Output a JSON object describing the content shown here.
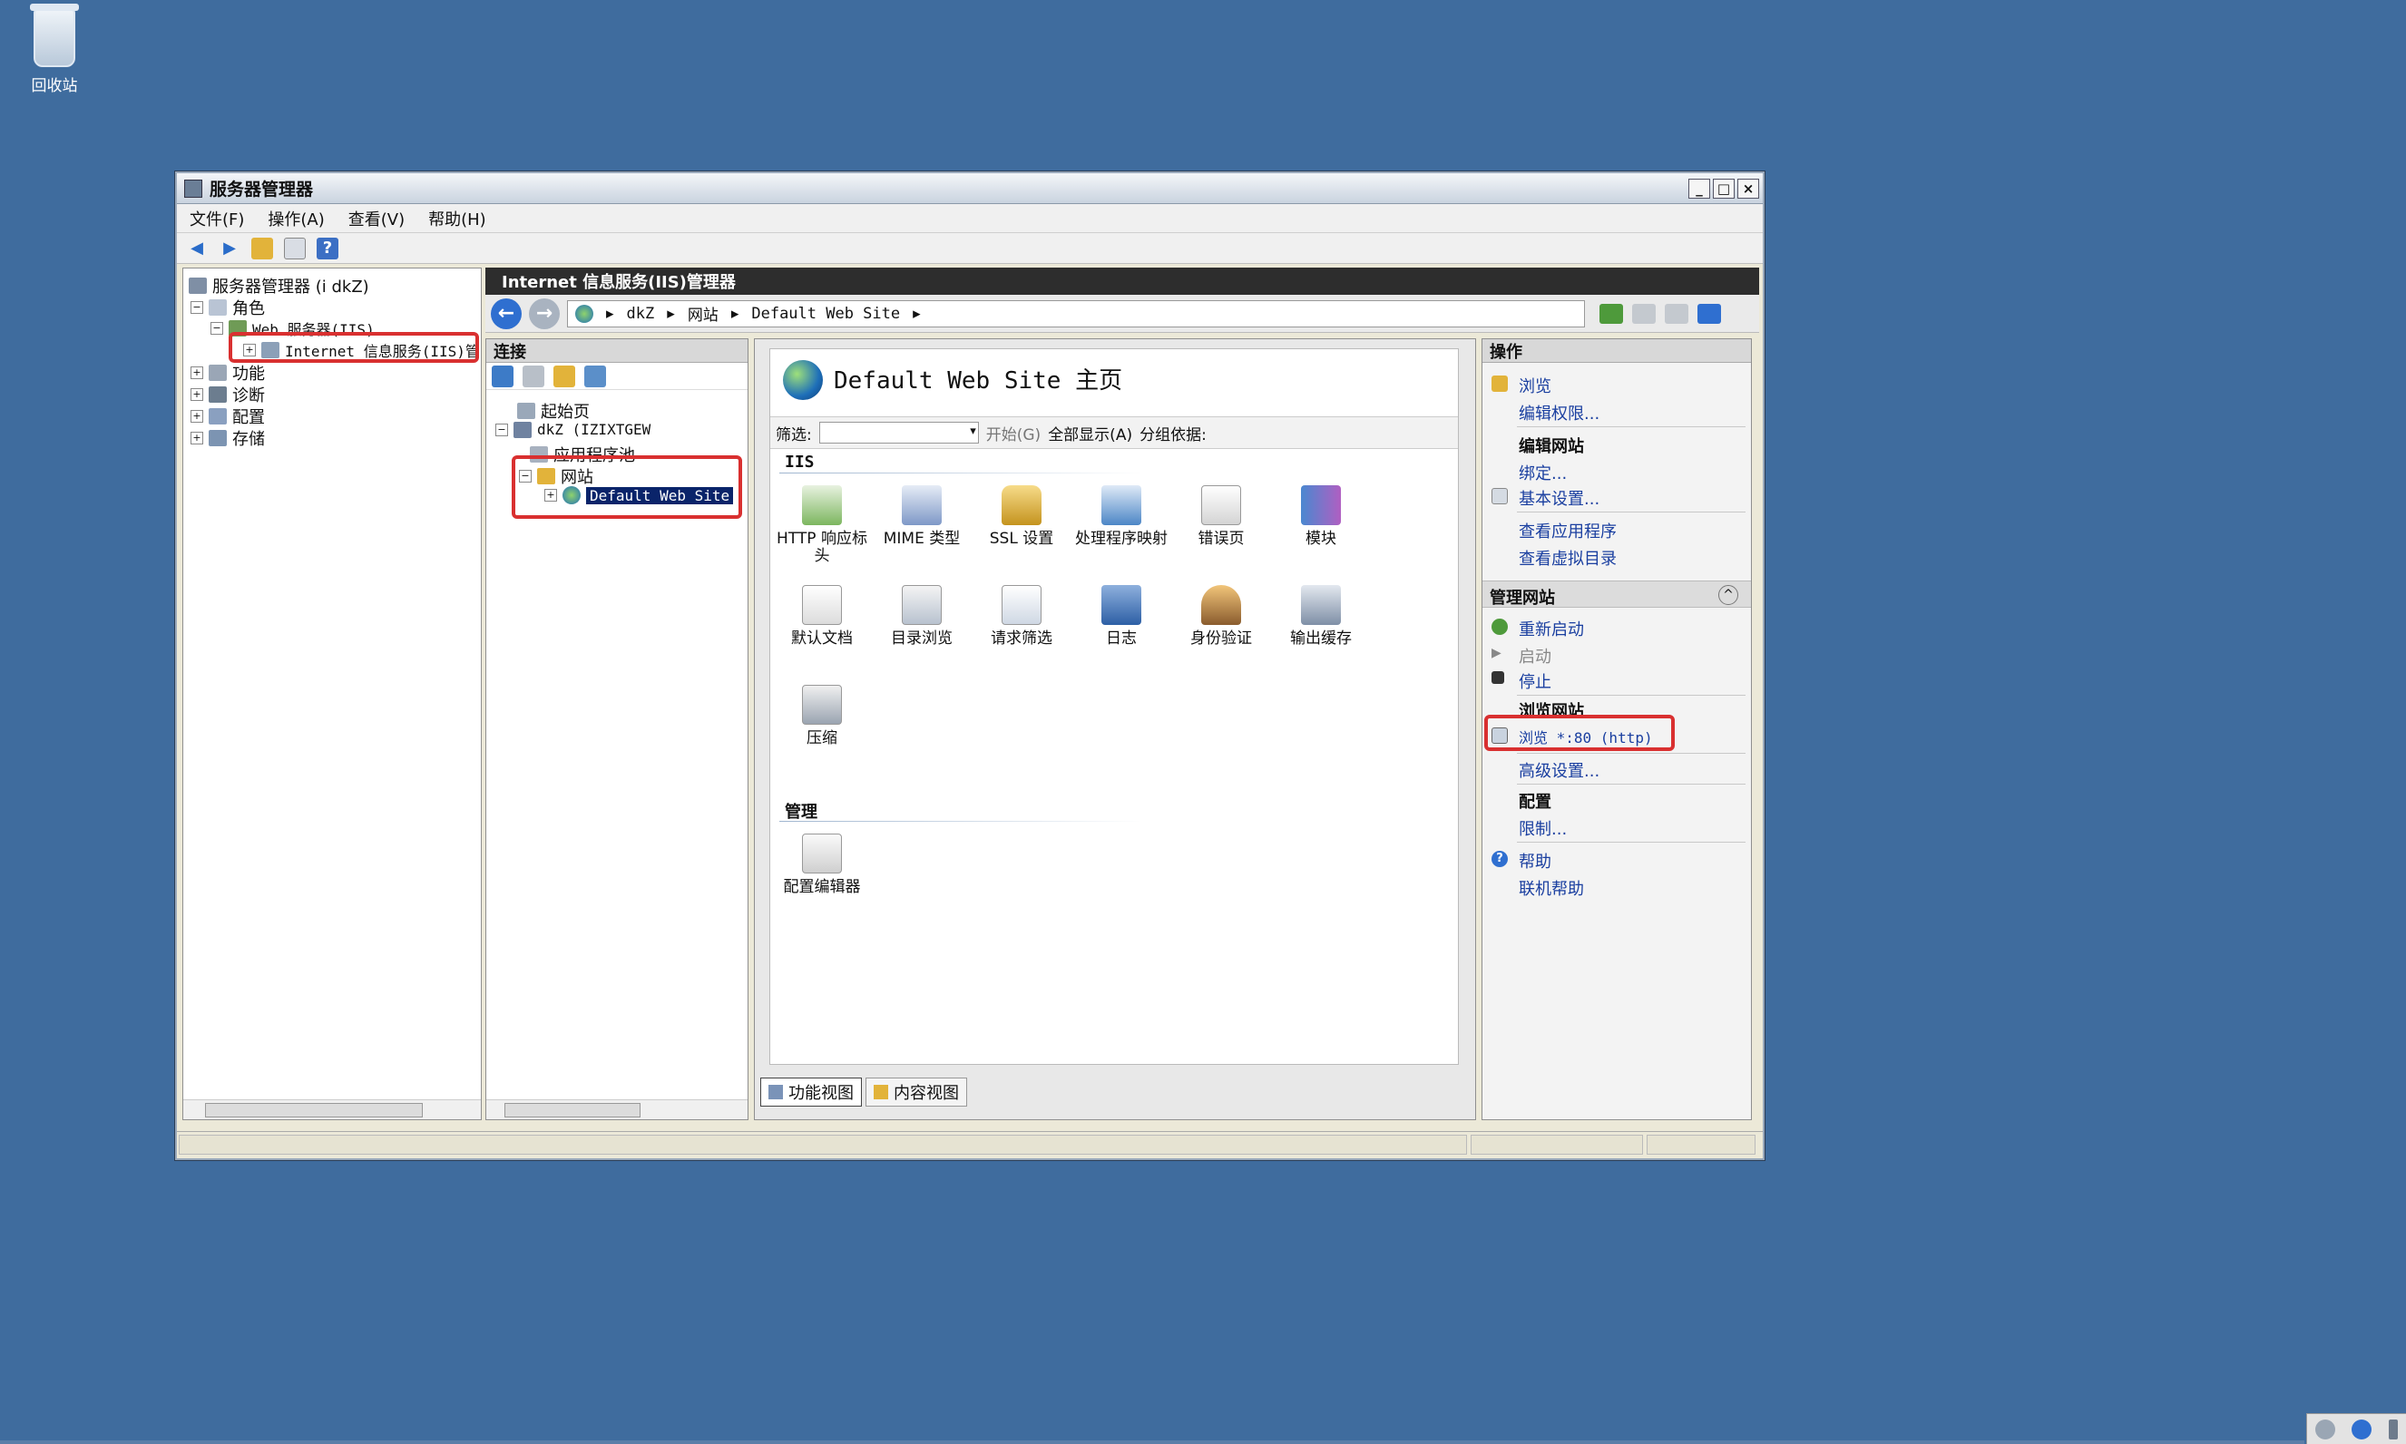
{
  "desktop": {
    "recycle_bin_label": "回收站"
  },
  "window": {
    "title": "服务器管理器",
    "menu": [
      "文件(F)",
      "操作(A)",
      "查看(V)",
      "帮助(H)"
    ]
  },
  "left_tree": {
    "root": "服务器管理器 (i          dkZ)",
    "roles": "角色",
    "web_server": "Web 服务器(IIS)",
    "iis_manager": "Internet 信息服务(IIS)管",
    "features": "功能",
    "diagnostics": "诊断",
    "configuration": "配置",
    "storage": "存储"
  },
  "iis": {
    "header": "Internet 信息服务(IIS)管理器",
    "address": [
      "               dkZ",
      "网站",
      "Default Web Site"
    ],
    "connections": {
      "title": "连接",
      "start_page": "起始页",
      "server": "          dkZ (IZIXTGEW",
      "app_pools": "应用程序池",
      "sites": "网站",
      "default_site": "Default Web Site"
    },
    "center": {
      "page_title": "Default Web Site 主页",
      "filter_label": "筛选:",
      "start_label": "开始(G)",
      "show_all_label": "全部显示(A)",
      "group_by_label": "分组依据:",
      "section_iis": "IIS",
      "features_iis": [
        {
          "label": "HTTP 响应标头",
          "icon": "http-response-headers-icon"
        },
        {
          "label": "MIME 类型",
          "icon": "mime-types-icon"
        },
        {
          "label": "SSL 设置",
          "icon": "ssl-lock-icon"
        },
        {
          "label": "处理程序映射",
          "icon": "handler-mappings-icon"
        },
        {
          "label": "错误页",
          "icon": "error-pages-icon"
        },
        {
          "label": "模块",
          "icon": "modules-icon"
        },
        {
          "label": "默认文档",
          "icon": "default-document-icon"
        },
        {
          "label": "目录浏览",
          "icon": "directory-browsing-icon"
        },
        {
          "label": "请求筛选",
          "icon": "request-filtering-icon"
        },
        {
          "label": "日志",
          "icon": "logging-icon"
        },
        {
          "label": "身份验证",
          "icon": "authentication-icon"
        },
        {
          "label": "输出缓存",
          "icon": "output-caching-icon"
        },
        {
          "label": "压缩",
          "icon": "compression-icon"
        }
      ],
      "section_manage": "管理",
      "features_manage": [
        {
          "label": "配置编辑器",
          "icon": "configuration-editor-icon"
        }
      ],
      "tab_features": "功能视图",
      "tab_content": "内容视图"
    },
    "actions": {
      "title": "操作",
      "browse": "浏览",
      "edit_permissions": "编辑权限...",
      "edit_site": "编辑网站",
      "bindings": "绑定...",
      "basic_settings": "基本设置...",
      "view_apps": "查看应用程序",
      "view_vdirs": "查看虚拟目录",
      "manage_site": "管理网站",
      "restart": "重新启动",
      "start": "启动",
      "stop": "停止",
      "browse_site": "浏览网站",
      "browse_80": "浏览 *:80 (http)",
      "advanced_settings": "高级设置...",
      "config": "配置",
      "limits": "限制...",
      "help": "帮助",
      "online_help": "联机帮助"
    }
  },
  "colors": {
    "desktop": "#3f6c9e",
    "highlight_box": "#d93030",
    "link": "#1a3fa0",
    "selected_node": "#0a246a"
  }
}
